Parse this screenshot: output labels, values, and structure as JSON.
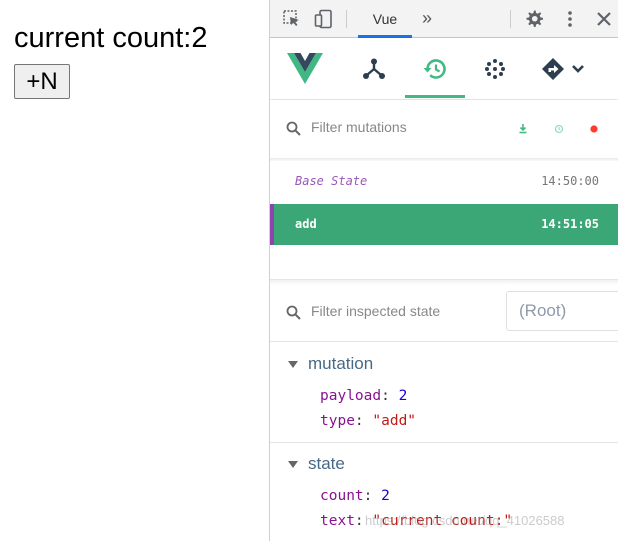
{
  "app": {
    "count_text": "current count:2",
    "button_label": "+N"
  },
  "devtools": {
    "toolbar": {
      "vue_tab": "Vue",
      "more_tabs": "»"
    },
    "nav": {
      "icons": [
        "vue-logo",
        "components-icon",
        "history-icon",
        "vuex-icon",
        "router-icon"
      ],
      "active": "history-icon",
      "accent_color": "#42b983"
    },
    "mutations": {
      "filter_placeholder": "Filter mutations",
      "entries": [
        {
          "name": "Base State",
          "time": "14:50:00",
          "selected": false
        },
        {
          "name": "add",
          "time": "14:51:05",
          "selected": true
        }
      ],
      "selected_color": "#3ba776"
    },
    "inspector": {
      "filter_placeholder": "Filter inspected state",
      "root_select": "(Root)",
      "mutation_section": {
        "title": "mutation",
        "fields": [
          {
            "key": "payload",
            "value": "2",
            "type": "number"
          },
          {
            "key": "type",
            "value": "\"add\"",
            "type": "string"
          }
        ]
      },
      "state_section": {
        "title": "state",
        "fields": [
          {
            "key": "count",
            "value": "2",
            "type": "number"
          },
          {
            "key": "text",
            "value": "\"current count:\"",
            "type": "string"
          }
        ]
      }
    }
  },
  "watermark": "https://blog.csdn.net/qq_41026588"
}
